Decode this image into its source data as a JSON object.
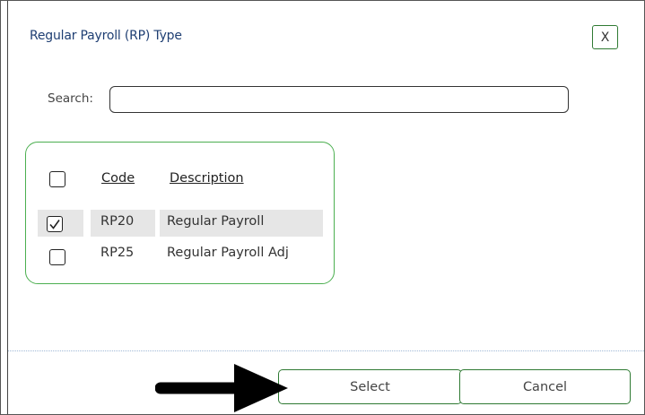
{
  "dialog": {
    "title": "Regular Payroll (RP) Type",
    "close_label": "X"
  },
  "search": {
    "label": "Search:",
    "value": "",
    "placeholder": ""
  },
  "table": {
    "columns": [
      "Code",
      "Description"
    ],
    "select_all_checked": false,
    "rows": [
      {
        "code": "RP20",
        "description": "Regular Payroll",
        "checked": true,
        "highlighted": true
      },
      {
        "code": "RP25",
        "description": "Regular Payroll Adj",
        "checked": false,
        "highlighted": false
      }
    ]
  },
  "footer": {
    "select_label": "Select",
    "cancel_label": "Cancel"
  },
  "colors": {
    "accent_border": "#4caf50",
    "button_border": "#2f7a33",
    "title_text": "#1f3f73",
    "row_highlight": "#e6e6e6"
  },
  "annotation_icon": "arrow-right-icon"
}
